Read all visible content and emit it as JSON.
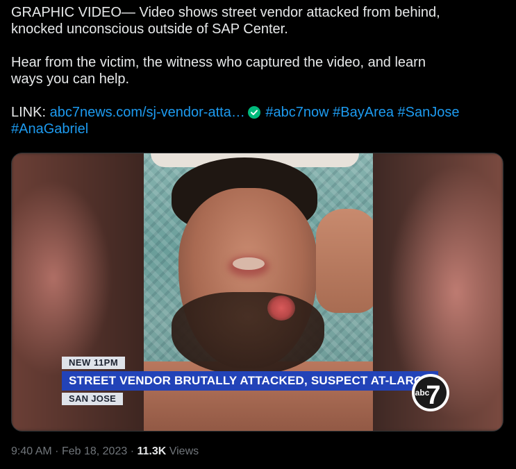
{
  "tweet": {
    "line1": "GRAPHIC VIDEO— Video shows street vendor attacked from behind,",
    "line2": "knocked unconscious outside of SAP Center.",
    "line3": "Hear from the victim, the witness who captured the video, and learn",
    "line4": "ways you can help.",
    "link_label": "LINK:",
    "link_url": "abc7news.com/sj-vendor-atta…",
    "hashtags": [
      "#abc7now",
      "#BayArea",
      "#SanJose",
      "#AnaGabriel"
    ],
    "colors": {
      "text": "#e7e9ea",
      "link": "#1d9bf0",
      "verified": "#00ba7c",
      "muted": "#71767b"
    },
    "verified_icon": "check-circle-icon"
  },
  "media": {
    "news_tag": "NEW 11PM",
    "headline": "STREET VENDOR BRUTALLY ATTACKED, SUSPECT AT-LARGE",
    "location": "SAN JOSE",
    "logo_text": "abc",
    "logo_number": "7",
    "colors": {
      "headline_bar": "#2243b8",
      "tag_bar": "#dfe3ea"
    }
  },
  "meta": {
    "time": "9:40 AM",
    "separator": "·",
    "date": "Feb 18, 2023",
    "views_count": "11.3K",
    "views_label": "Views"
  }
}
